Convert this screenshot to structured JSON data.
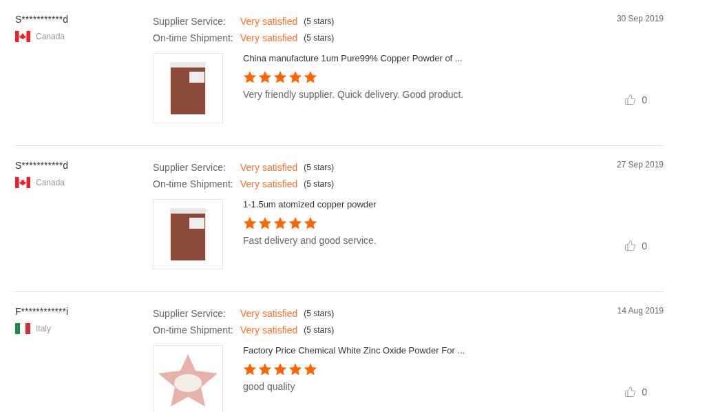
{
  "reviews": [
    {
      "reviewer": "S***********d",
      "country": "Canada",
      "flag": {
        "kind": "ca"
      },
      "date": "30 Sep 2019",
      "ratings": [
        {
          "label": "Supplier Service:",
          "value": "Very satisfied",
          "note": "(5 stars)"
        },
        {
          "label": "On-time Shipment:",
          "value": "Very satisfied",
          "note": "(5 stars)"
        }
      ],
      "photo": {
        "kind": "bag"
      },
      "product": "China manufacture 1um Pure99% Copper Powder of ...",
      "stars": 5,
      "comment": "Very friendly supplier.  Quick delivery.  Good product.",
      "likes": "0"
    },
    {
      "reviewer": "S***********d",
      "country": "Canada",
      "flag": {
        "kind": "ca"
      },
      "date": "27 Sep 2019",
      "ratings": [
        {
          "label": "Supplier Service:",
          "value": "Very satisfied",
          "note": "(5 stars)"
        },
        {
          "label": "On-time Shipment:",
          "value": "Very satisfied",
          "note": "(5 stars)"
        }
      ],
      "photo": {
        "kind": "bag"
      },
      "product": "1-1.5um atomized copper powder",
      "stars": 5,
      "comment": "Fast delivery and good service.",
      "likes": "0"
    },
    {
      "reviewer": "F************i",
      "country": "Italy",
      "flag": {
        "kind": "it"
      },
      "date": "14 Aug 2019",
      "ratings": [
        {
          "label": "Supplier Service:",
          "value": "Very satisfied",
          "note": "(5 stars)"
        },
        {
          "label": "On-time Shipment:",
          "value": "Very satisfied",
          "note": "(5 stars)"
        }
      ],
      "photo": {
        "kind": "dish"
      },
      "product": "Factory Price Chemical White Zinc Oxide Powder For ...",
      "stars": 5,
      "comment": "good quality",
      "likes": "0"
    }
  ]
}
